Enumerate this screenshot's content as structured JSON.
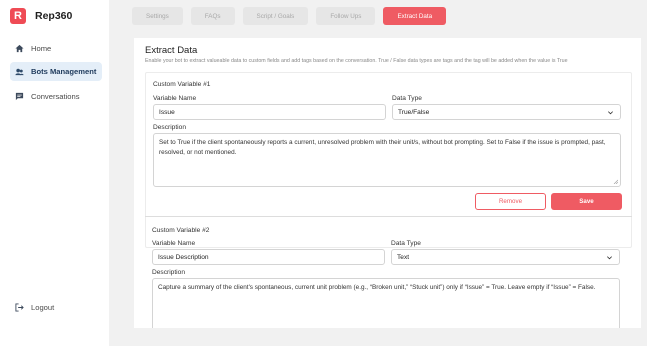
{
  "app": {
    "logo_letter": "R",
    "name": "Rep360"
  },
  "sidebar": {
    "items": [
      {
        "label": "Home",
        "icon": "home-icon"
      },
      {
        "label": "Bots Management",
        "icon": "bots-icon"
      },
      {
        "label": "Conversations",
        "icon": "chat-icon"
      }
    ],
    "logout_label": "Logout"
  },
  "tabs": [
    {
      "label": "Settings"
    },
    {
      "label": "FAQs"
    },
    {
      "label": "Script / Goals"
    },
    {
      "label": "Follow Ups"
    },
    {
      "label": "Extract Data",
      "active": true
    }
  ],
  "extract": {
    "title": "Extract Data",
    "subtitle": "Enable your bot to extract valueable data to custom fields and add tags based on the conversation. True / False data types are tags and the tag will be added when the value is True",
    "variables": [
      {
        "heading": "Custom Variable #1",
        "name_label": "Variable Name",
        "name_value": "Issue",
        "type_label": "Data Type",
        "type_value": "True/False",
        "desc_label": "Description",
        "desc_value": "Set to True if the client spontaneously reports a current, unresolved problem with their unit/s, without bot prompting. Set to False if the issue is prompted, past, resolved, or not mentioned.",
        "remove_label": "Remove",
        "save_label": "Save"
      },
      {
        "heading": "Custom Variable #2",
        "name_label": "Variable Name",
        "name_value": "Issue Description",
        "type_label": "Data Type",
        "type_value": "Text",
        "desc_label": "Description",
        "desc_value": "Capture a summary of the client's spontaneous, current unit problem (e.g., “Broken unit,” “Stuck unit”) only if “Issue” = True. Leave empty if “Issue” = False."
      }
    ]
  },
  "colors": {
    "accent": "#ef5b63",
    "active_nav_bg": "#e4eef8"
  }
}
